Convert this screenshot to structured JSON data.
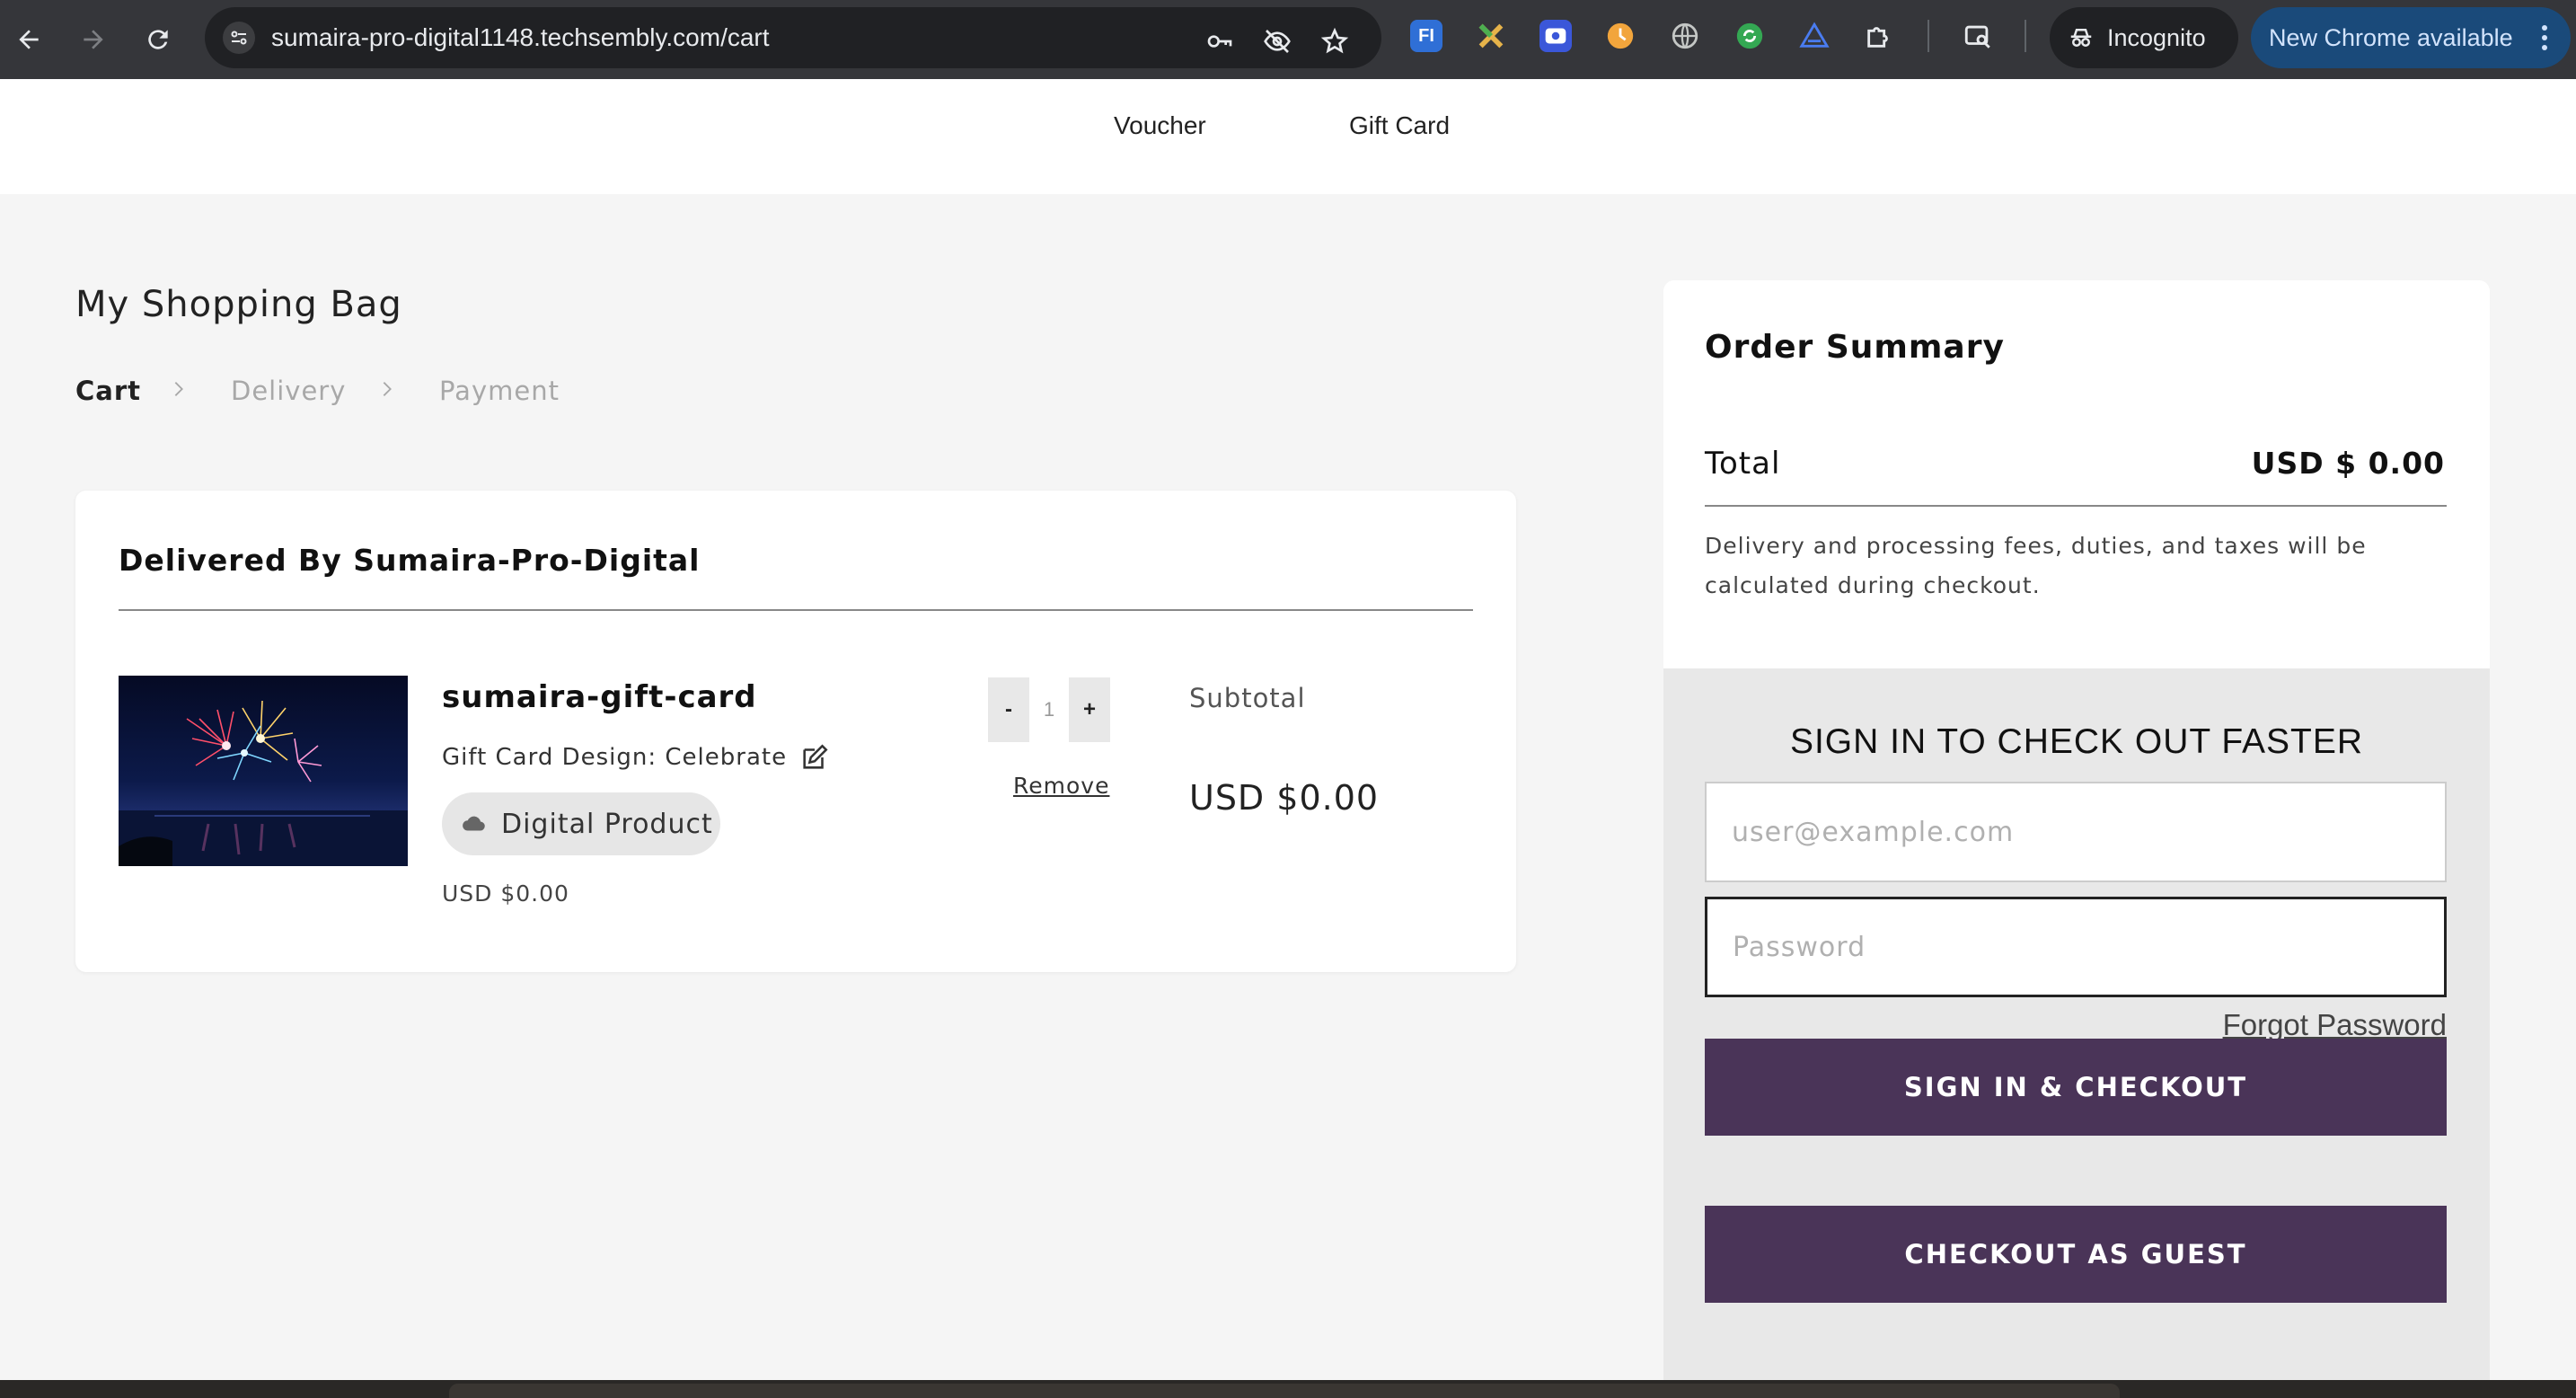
{
  "browser": {
    "url": "sumaira-pro-digital1148.techsembly.com/cart",
    "incognito_label": "Incognito",
    "update_label": "New Chrome available",
    "extensions": [
      "FI",
      "x-extension",
      "screen-record",
      "clock-extension",
      "globe",
      "green-refresh",
      "triangle-extension",
      "puzzle-icon",
      "search-tab-icon"
    ]
  },
  "topnav": {
    "voucher": "Voucher",
    "gift_card": "Gift Card"
  },
  "page": {
    "title": "My Shopping Bag",
    "steps": [
      "Cart",
      "Delivery",
      "Payment"
    ],
    "active_step": "Cart"
  },
  "cart": {
    "seller_title": "Delivered By Sumaira-Pro-Digital",
    "item": {
      "name": "sumaira-gift-card",
      "design_label": "Gift Card Design: Celebrate",
      "badge": "Digital Product",
      "unit_price": "USD $0.00",
      "quantity": "1",
      "minus_label": "-",
      "plus_label": "+",
      "remove_label": "Remove",
      "subtotal_label": "Subtotal",
      "subtotal_value": "USD $0.00"
    }
  },
  "summary": {
    "title": "Order Summary",
    "total_label": "Total",
    "total_value": "USD $ 0.00",
    "fees_note": "Delivery and processing fees, duties, and taxes will be calculated during checkout.",
    "signin_heading": "SIGN IN TO CHECK OUT FASTER",
    "email_placeholder": "user@example.com",
    "password_placeholder": "Password",
    "forgot_label": "Forgot Password",
    "signin_button": "SIGN IN & CHECKOUT",
    "guest_button": "CHECKOUT AS GUEST"
  },
  "colors": {
    "primary_button": "#4a3458",
    "chrome_bar": "#35363a",
    "update_pill": "#1a4a7a"
  }
}
